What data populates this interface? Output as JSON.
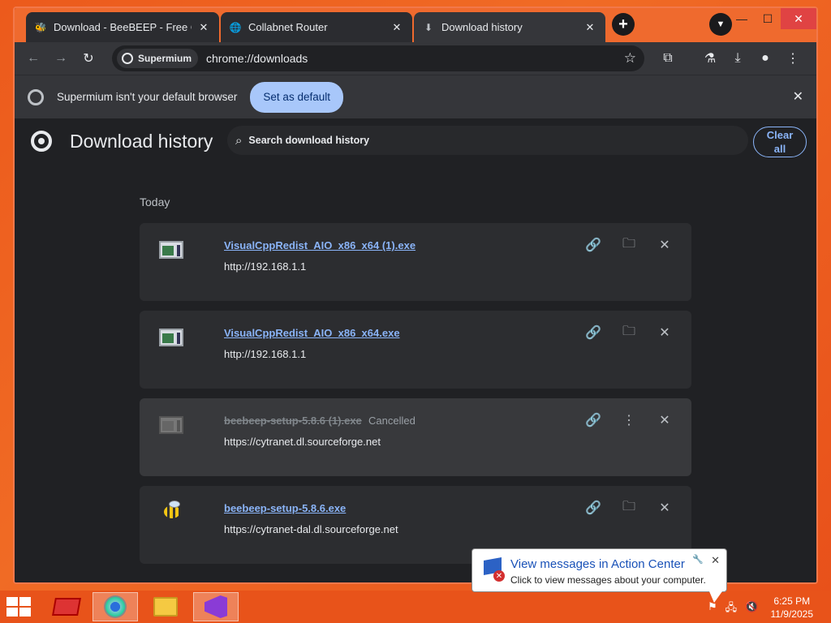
{
  "tabs": [
    {
      "title": "Download - BeeBEEP - Free Offi",
      "icon": "bee-icon"
    },
    {
      "title": "Collabnet Router",
      "icon": "globe-icon"
    },
    {
      "title": "Download history",
      "icon": "download-icon"
    }
  ],
  "toolbar": {
    "site_chip": "Supermium",
    "url": "chrome://downloads"
  },
  "infobar": {
    "message": "Supermium isn't your default browser",
    "button": "Set as default"
  },
  "page": {
    "title": "Download history",
    "search_placeholder": "Search download history",
    "clear_all": "Clear all",
    "section": "Today"
  },
  "downloads": [
    {
      "name": "VisualCppRedist_AIO_x86_x64 (1).exe",
      "url": "http://192.168.1.1",
      "status": ""
    },
    {
      "name": "VisualCppRedist_AIO_x86_x64.exe",
      "url": "http://192.168.1.1",
      "status": ""
    },
    {
      "name": "beebeep-setup-5.8.6 (1).exe",
      "url": "https://cytranet.dl.sourceforge.net",
      "status": "Cancelled"
    },
    {
      "name": "beebeep-setup-5.8.6.exe",
      "url": "https://cytranet-dal.dl.sourceforge.net",
      "status": ""
    }
  ],
  "balloon": {
    "title": "View messages in Action Center",
    "text": "Click to view messages about your computer."
  },
  "clock": {
    "time": "6:25 PM",
    "date": "11/9/2025"
  },
  "colors": {
    "accent": "#8ab4f8",
    "taskbar": "#e8531a",
    "page_bg": "#202124"
  }
}
